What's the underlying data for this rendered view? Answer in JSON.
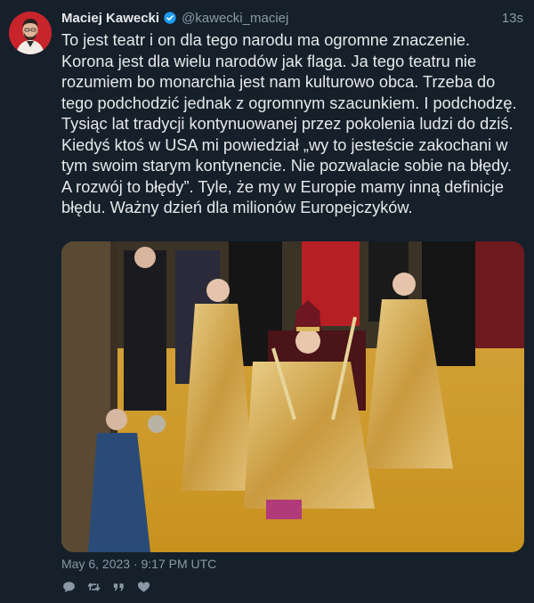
{
  "theme": {
    "background": "#15202b",
    "verified_color": "#1d9bf0",
    "avatar_color": "#c8242c"
  },
  "tweet": {
    "author_name": "Maciej Kawecki",
    "author_handle": "@kawecki_maciej",
    "relative_time": "13s",
    "text": "To jest teatr i on dla tego narodu ma ogromne znaczenie. Korona jest dla wielu narodów jak flaga. Ja tego teatru nie rozumiem bo monarchia jest nam kulturowo obca. Trzeba do tego podchodzić jednak z ogromnym szacunkiem. I podchodzę. Tysiąc lat tradycji kontynuowanej przez pokolenia ludzi do dziś. Kiedyś ktoś w USA mi powiedział „wy to jesteście zakochani w tym swoim starym kontynencie. Nie pozwalacie sobie na błędy. A rozwój to błędy”. Tyle, że my w Europie mamy inną definicje błędu. Ważny dzień dla milionów Europejczyków.",
    "timestamp": "May 6, 2023 · 9:17 PM UTC"
  },
  "icons": {
    "verified": "verified-badge-icon",
    "reply": "speech-bubble-icon",
    "retweet": "retweet-arrows-icon",
    "quote": "quote-marks-icon",
    "like": "heart-icon"
  }
}
